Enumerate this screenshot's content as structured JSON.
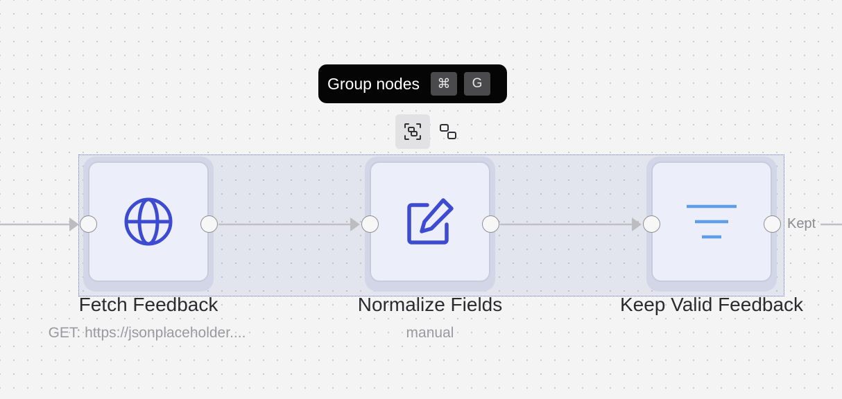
{
  "tooltip": {
    "label": "Group nodes",
    "shortcut_keys": [
      "⌘",
      "G"
    ]
  },
  "toolbar": {
    "buttons": [
      {
        "name": "group-nodes",
        "icon": "group-selection-icon",
        "active": true
      },
      {
        "name": "ungroup",
        "icon": "ungroup-icon",
        "active": false
      }
    ]
  },
  "nodes": [
    {
      "title": "Fetch Feedback",
      "subtitle": "GET: https://jsonplaceholder....",
      "icon": "globe-icon",
      "icon_color": "#3d4bd1"
    },
    {
      "title": "Normalize Fields",
      "subtitle": "manual",
      "icon": "edit-icon",
      "icon_color": "#3d4bd1"
    },
    {
      "title": "Keep Valid Feedback",
      "subtitle": "",
      "icon": "filter-icon",
      "icon_color": "#5f9de6"
    }
  ],
  "edges": [
    {
      "from": "incoming",
      "to": "Fetch Feedback",
      "label": ""
    },
    {
      "from": "Fetch Feedback",
      "to": "Normalize Fields",
      "label": ""
    },
    {
      "from": "Normalize Fields",
      "to": "Keep Valid Feedback",
      "label": ""
    },
    {
      "from": "Keep Valid Feedback",
      "to": "outgoing",
      "label": "Kept"
    }
  ],
  "colors": {
    "canvas_background": "#f4f4f4",
    "selection_fill": "#6c78c4",
    "edge": "#c0c0c4",
    "accent": "#3d4bd1"
  }
}
